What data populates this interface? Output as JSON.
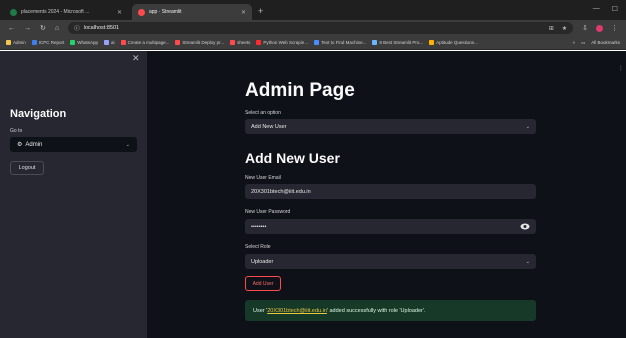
{
  "browser": {
    "tabs": [
      {
        "title": "placements 2024 - Microsoft ...",
        "active": false
      },
      {
        "title": "app · Streamlit",
        "active": true
      }
    ],
    "url": "localhost:8501",
    "bookmarks": [
      {
        "label": "Admin",
        "color": "#f2c94c"
      },
      {
        "label": "ICPC Report",
        "color": "#3d7eea"
      },
      {
        "label": "WhatsApp",
        "color": "#25d366"
      },
      {
        "label": "ai",
        "color": "#9aa0ff"
      },
      {
        "label": "Create a multipage...",
        "color": "#ff4b4b"
      },
      {
        "label": "Streamlit Deploy pr...",
        "color": "#ff4b4b"
      },
      {
        "label": "sheets",
        "color": "#ff4b4b"
      },
      {
        "label": "Python Web Scrapin...",
        "color": "#ff2a2a"
      },
      {
        "label": "Text to Find Machine...",
        "color": "#4a8cff"
      },
      {
        "label": "8 Best Streamlit Pro...",
        "color": "#6bb7ff"
      },
      {
        "label": "Aptitude Questions...",
        "color": "#ffb300"
      }
    ],
    "all_bookmarks_label": "All Bookmarks"
  },
  "sidebar": {
    "title": "Navigation",
    "goto_label": "Go to",
    "selected_page": "Admin",
    "logout_label": "Logout"
  },
  "main": {
    "page_title": "Admin Page",
    "select_option_label": "Select an option",
    "select_option_value": "Add New User",
    "section_title": "Add New User",
    "email_label": "New User Email",
    "email_value": "20X301btech@iiit.edu.in",
    "password_label": "New User Password",
    "password_value": "••••••••",
    "role_label": "Select Role",
    "role_value": "Uploader",
    "add_button_label": "Add User",
    "success_prefix": "User '",
    "success_email": "20X301btech@iiit.edu.in",
    "success_suffix": "' added successfully with role 'Uploader'."
  },
  "colors": {
    "primary": "#ff4b4b",
    "app_bg": "#0e1117",
    "sidebar_bg": "#262730",
    "success_bg": "#173928"
  }
}
